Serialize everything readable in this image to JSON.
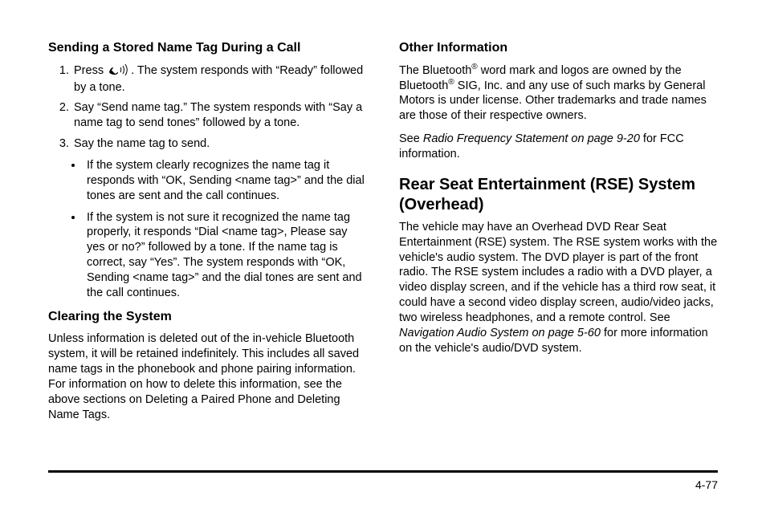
{
  "left": {
    "h_send": "Sending a Stored Name Tag During a Call",
    "step1_a": "Press ",
    "step1_b": " . The system responds with “Ready” followed by a tone.",
    "step2": "Say “Send name tag.” The system responds with “Say a name tag to send tones” followed by a tone.",
    "step3": "Say the name tag to send.",
    "bullet1": "If the system clearly recognizes the name tag it responds with “OK, Sending <name tag>” and the dial tones are sent and the call continues.",
    "bullet2": "If the system is not sure it recognized the name tag properly, it responds “Dial <name tag>, Please say yes or no?” followed by a tone. If the name tag is correct, say “Yes”. The system responds with “OK, Sending <name tag>” and the dial tones are sent and the call continues.",
    "h_clear": "Clearing the System",
    "clear_body": "Unless information is deleted out of the in-vehicle Bluetooth system, it will be retained indefinitely. This includes all saved name tags in the phonebook and phone pairing information. For information on how to delete this information, see the above sections on Deleting a Paired Phone and Deleting Name Tags."
  },
  "right": {
    "h_other": "Other Information",
    "other_p1_a": "The Bluetooth",
    "other_p1_b": " word mark and logos are owned by the Bluetooth",
    "other_p1_c": " SIG, Inc. and any use of such marks by General Motors is under license. Other trademarks and trade names are those of their respective owners.",
    "other_p2_a": "See ",
    "other_p2_ital": "Radio Frequency Statement on page 9-20",
    "other_p2_b": " for FCC information.",
    "h_rse": "Rear Seat Entertainment (RSE) System (Overhead)",
    "rse_p_a": "The vehicle may have an Overhead DVD Rear Seat Entertainment (RSE) system. The RSE system works with the vehicle's audio system. The DVD player is part of the front radio. The RSE system includes a radio with a DVD player, a video display screen, and if the vehicle has a third row seat, it could have a second video display screen, audio/video jacks, two wireless headphones, and a remote control. See ",
    "rse_p_ital": "Navigation Audio System on page 5-60",
    "rse_p_b": " for more information on the vehicle's audio/DVD system.",
    "reg": "®"
  },
  "page_number": "4-77"
}
